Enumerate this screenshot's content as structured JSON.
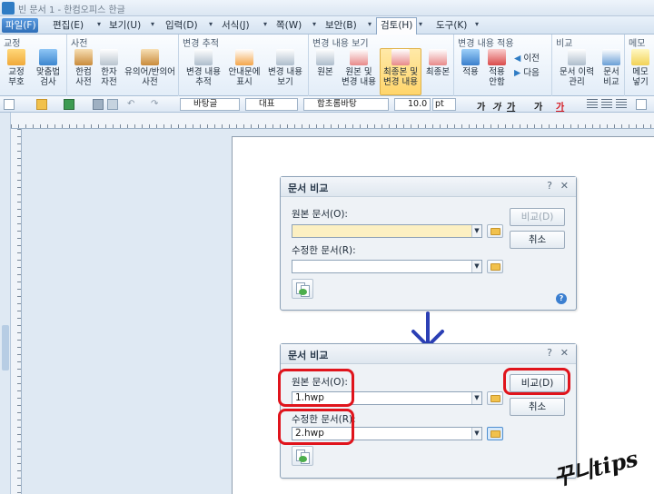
{
  "window": {
    "title": "빈 문서 1 - 한컴오피스 한글"
  },
  "menubar": {
    "items": [
      "파일(F)",
      "편집(E)",
      "보기(U)",
      "입력(D)",
      "서식(J)",
      "쪽(W)",
      "보안(B)",
      "검토(H)",
      "도구(K)"
    ],
    "active": "검토(H)"
  },
  "ribbon": {
    "groups": {
      "proofing": "교정",
      "dictionary": "사전",
      "track_changes": "변경 추적",
      "view_changes": "변경 내용 보기",
      "apply_changes": "변경 내용 적용",
      "compare": "비교",
      "memo": "메모"
    },
    "buttons": {
      "proof_mark": "교정\n부호",
      "spell_check": "맞춤법\n검사",
      "hancom_dict": "한컴\n사전",
      "hanja_dict": "한자\n자전",
      "thesaurus": "유의어/반의어\n사전",
      "track_changes": "변경 내용\n추적",
      "show_in_balloon": "안내문에\n표시",
      "save_changes": "변경 내용\n보기",
      "original": "원본",
      "original_and_changes": "원본 및\n변경 내용",
      "final_and_changes": "최종본 및\n변경 내용",
      "final": "최종본",
      "apply": "적용",
      "reject": "적용\n안함",
      "previous": "이전",
      "next": "다음",
      "compare_history": "문서 이력\n관리",
      "compare_docs": "문서\n비교",
      "insert_memo": "메모\n넣기"
    }
  },
  "formatbar": {
    "style": "바탕글",
    "lang": "대표",
    "font": "함초롬바탕",
    "size": "10.0",
    "unit": "pt",
    "bold": "가",
    "italic": "가",
    "underline": "가",
    "strike": "가",
    "color": "가"
  },
  "dialog_before": {
    "title": "문서 비교",
    "help": "?",
    "close": "✕",
    "original_label": "원본 문서(O):",
    "original_value": "",
    "modified_label": "수정한 문서(R):",
    "modified_value": "",
    "compare_btn": "비교(D)",
    "cancel_btn": "취소"
  },
  "dialog_after": {
    "title": "문서 비교",
    "help": "?",
    "close": "✕",
    "original_label": "원본 문서(O):",
    "original_value": "1.hwp",
    "modified_label": "수정한 문서(R):",
    "modified_value": "2.hwp",
    "compare_btn": "비교(D)",
    "cancel_btn": "취소"
  },
  "watermark": "꾸니tips",
  "colors": {
    "highlight": "#e0141c",
    "arrow": "#2b3fb4",
    "accent": "#2f6fb8"
  }
}
